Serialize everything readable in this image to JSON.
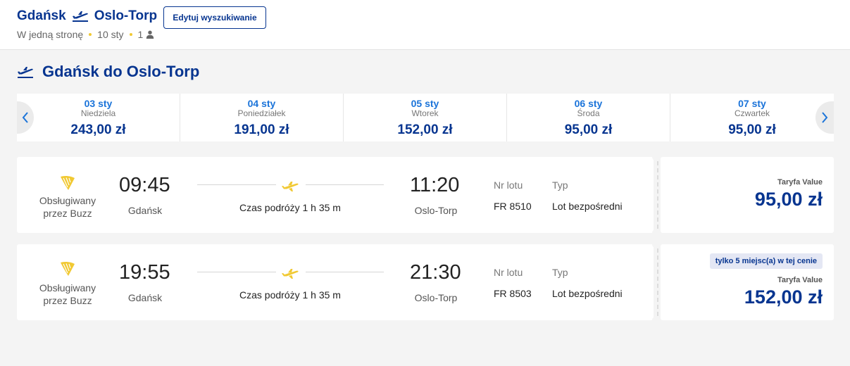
{
  "header": {
    "origin": "Gdańsk",
    "destination": "Oslo-Torp",
    "trip_type": "W jedną stronę",
    "date": "10 sty",
    "passengers": "1",
    "edit_button": "Edytuj wyszukiwanie"
  },
  "section_title": "Gdańsk do Oslo-Torp",
  "dates": [
    {
      "date": "03 sty",
      "weekday": "Niedziela",
      "price": "243,00 zł"
    },
    {
      "date": "04 sty",
      "weekday": "Poniedziałek",
      "price": "191,00 zł"
    },
    {
      "date": "05 sty",
      "weekday": "Wtorek",
      "price": "152,00 zł"
    },
    {
      "date": "06 sty",
      "weekday": "Środa",
      "price": "95,00 zł"
    },
    {
      "date": "07 sty",
      "weekday": "Czwartek",
      "price": "95,00 zł"
    }
  ],
  "flights": [
    {
      "operator": "Obsługiwany przez Buzz",
      "depart_time": "09:45",
      "depart_city": "Gdańsk",
      "duration": "Czas podróży 1 h 35 m",
      "arrive_time": "11:20",
      "arrive_city": "Oslo-Torp",
      "flight_no_label": "Nr lotu",
      "flight_no": "FR 8510",
      "type_label": "Typ",
      "type": "Lot bezpośredni",
      "fare_name": "Taryfa Value",
      "price": "95,00 zł",
      "seat_note": ""
    },
    {
      "operator": "Obsługiwany przez Buzz",
      "depart_time": "19:55",
      "depart_city": "Gdańsk",
      "duration": "Czas podróży 1 h 35 m",
      "arrive_time": "21:30",
      "arrive_city": "Oslo-Torp",
      "flight_no_label": "Nr lotu",
      "flight_no": "FR 8503",
      "type_label": "Typ",
      "type": "Lot bezpośredni",
      "fare_name": "Taryfa Value",
      "price": "152,00 zł",
      "seat_note": "tylko 5 miejsc(a) w tej cenie"
    }
  ],
  "colors": {
    "brand_blue": "#073590",
    "date_blue": "#1a73d9",
    "accent_yellow": "#f1c933"
  },
  "icons": {
    "route": "plane-icon",
    "passenger": "person-icon",
    "prev": "chevron-left-icon",
    "next": "chevron-right-icon",
    "operator": "harp-logo-icon"
  }
}
